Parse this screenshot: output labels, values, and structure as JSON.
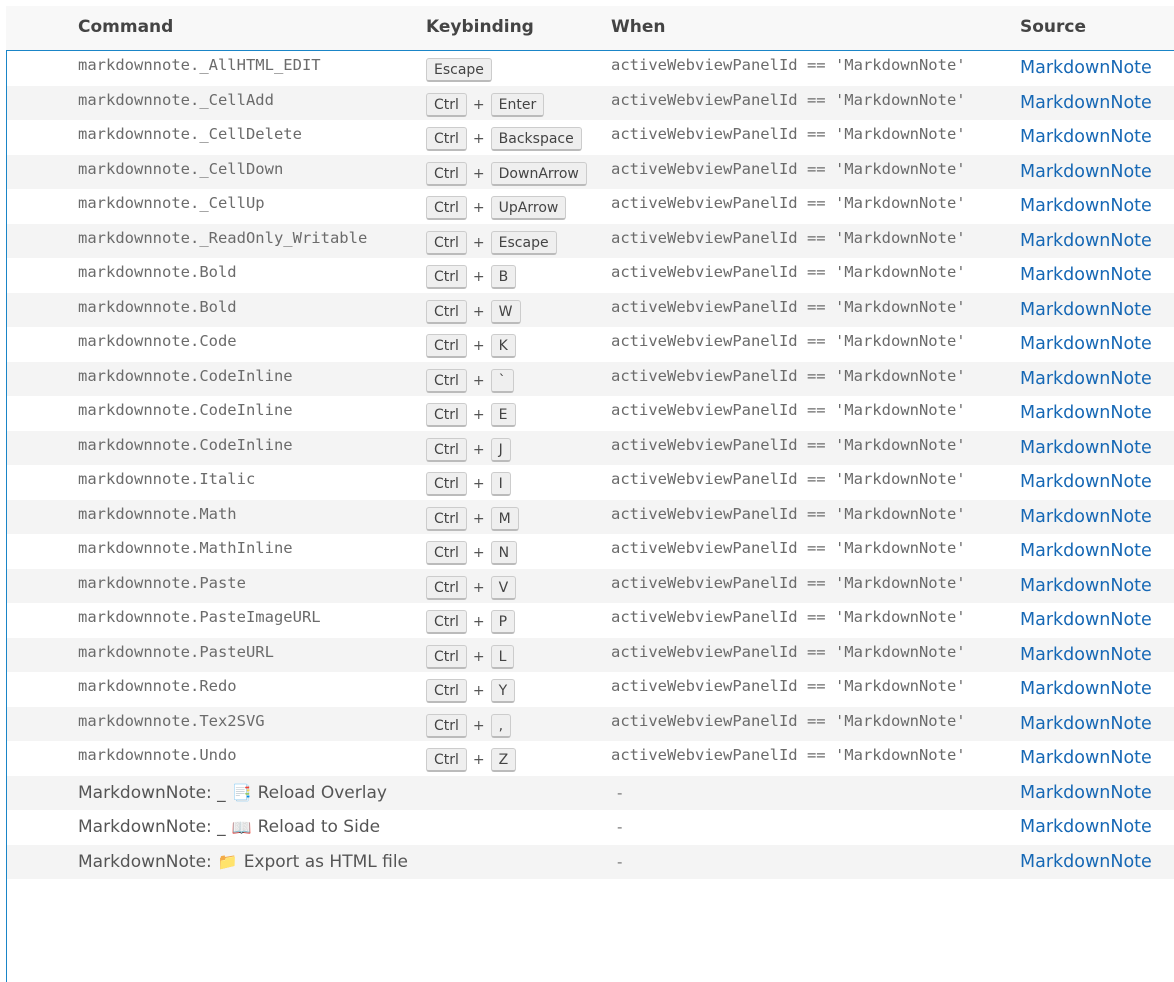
{
  "headers": {
    "command": "Command",
    "keybinding": "Keybinding",
    "when": "When",
    "source": "Source"
  },
  "colors": {
    "accent": "#1a85c7",
    "link": "#1668b5",
    "alt_row": "#f4f4f4"
  },
  "rows": [
    {
      "command": "markdownnote._AllHTML_EDIT",
      "keys": [
        "Escape"
      ],
      "when": "activeWebviewPanelId == 'MarkdownNote'",
      "source": "MarkdownNote"
    },
    {
      "command": "markdownnote._CellAdd",
      "keys": [
        "Ctrl",
        "Enter"
      ],
      "when": "activeWebviewPanelId == 'MarkdownNote'",
      "source": "MarkdownNote"
    },
    {
      "command": "markdownnote._CellDelete",
      "keys": [
        "Ctrl",
        "Backspace"
      ],
      "when": "activeWebviewPanelId == 'MarkdownNote'",
      "source": "MarkdownNote"
    },
    {
      "command": "markdownnote._CellDown",
      "keys": [
        "Ctrl",
        "DownArrow"
      ],
      "when": "activeWebviewPanelId == 'MarkdownNote'",
      "source": "MarkdownNote"
    },
    {
      "command": "markdownnote._CellUp",
      "keys": [
        "Ctrl",
        "UpArrow"
      ],
      "when": "activeWebviewPanelId == 'MarkdownNote'",
      "source": "MarkdownNote"
    },
    {
      "command": "markdownnote._ReadOnly_Writable",
      "keys": [
        "Ctrl",
        "Escape"
      ],
      "when": "activeWebviewPanelId == 'MarkdownNote'",
      "source": "MarkdownNote"
    },
    {
      "command": "markdownnote.Bold",
      "keys": [
        "Ctrl",
        "B"
      ],
      "when": "activeWebviewPanelId == 'MarkdownNote'",
      "source": "MarkdownNote"
    },
    {
      "command": "markdownnote.Bold",
      "keys": [
        "Ctrl",
        "W"
      ],
      "when": "activeWebviewPanelId == 'MarkdownNote'",
      "source": "MarkdownNote"
    },
    {
      "command": "markdownnote.Code",
      "keys": [
        "Ctrl",
        "K"
      ],
      "when": "activeWebviewPanelId == 'MarkdownNote'",
      "source": "MarkdownNote"
    },
    {
      "command": "markdownnote.CodeInline",
      "keys": [
        "Ctrl",
        "`"
      ],
      "when": "activeWebviewPanelId == 'MarkdownNote'",
      "source": "MarkdownNote"
    },
    {
      "command": "markdownnote.CodeInline",
      "keys": [
        "Ctrl",
        "E"
      ],
      "when": "activeWebviewPanelId == 'MarkdownNote'",
      "source": "MarkdownNote"
    },
    {
      "command": "markdownnote.CodeInline",
      "keys": [
        "Ctrl",
        "J"
      ],
      "when": "activeWebviewPanelId == 'MarkdownNote'",
      "source": "MarkdownNote"
    },
    {
      "command": "markdownnote.Italic",
      "keys": [
        "Ctrl",
        "I"
      ],
      "when": "activeWebviewPanelId == 'MarkdownNote'",
      "source": "MarkdownNote"
    },
    {
      "command": "markdownnote.Math",
      "keys": [
        "Ctrl",
        "M"
      ],
      "when": "activeWebviewPanelId == 'MarkdownNote'",
      "source": "MarkdownNote"
    },
    {
      "command": "markdownnote.MathInline",
      "keys": [
        "Ctrl",
        "N"
      ],
      "when": "activeWebviewPanelId == 'MarkdownNote'",
      "source": "MarkdownNote"
    },
    {
      "command": "markdownnote.Paste",
      "keys": [
        "Ctrl",
        "V"
      ],
      "when": "activeWebviewPanelId == 'MarkdownNote'",
      "source": "MarkdownNote"
    },
    {
      "command": "markdownnote.PasteImageURL",
      "keys": [
        "Ctrl",
        "P"
      ],
      "when": "activeWebviewPanelId == 'MarkdownNote'",
      "source": "MarkdownNote"
    },
    {
      "command": "markdownnote.PasteURL",
      "keys": [
        "Ctrl",
        "L"
      ],
      "when": "activeWebviewPanelId == 'MarkdownNote'",
      "source": "MarkdownNote"
    },
    {
      "command": "markdownnote.Redo",
      "keys": [
        "Ctrl",
        "Y"
      ],
      "when": "activeWebviewPanelId == 'MarkdownNote'",
      "source": "MarkdownNote"
    },
    {
      "command": "markdownnote.Tex2SVG",
      "keys": [
        "Ctrl",
        ","
      ],
      "when": "activeWebviewPanelId == 'MarkdownNote'",
      "source": "MarkdownNote"
    },
    {
      "command": "markdownnote.Undo",
      "keys": [
        "Ctrl",
        "Z"
      ],
      "when": "activeWebviewPanelId == 'MarkdownNote'",
      "source": "MarkdownNote"
    }
  ],
  "palette_rows": [
    {
      "prefix": "MarkdownNote: _",
      "emoji": "📑",
      "emoji_name": "bookmark-tabs-icon",
      "label": "Reload Overlay",
      "when": "-",
      "source": "MarkdownNote"
    },
    {
      "prefix": "MarkdownNote: _",
      "emoji": "📖",
      "emoji_name": "open-book-icon",
      "label": "Reload to Side",
      "when": "-",
      "source": "MarkdownNote"
    },
    {
      "prefix": "MarkdownNote:",
      "emoji": "📁",
      "emoji_name": "folder-icon",
      "label": "Export as HTML file",
      "when": "-",
      "source": "MarkdownNote"
    }
  ]
}
